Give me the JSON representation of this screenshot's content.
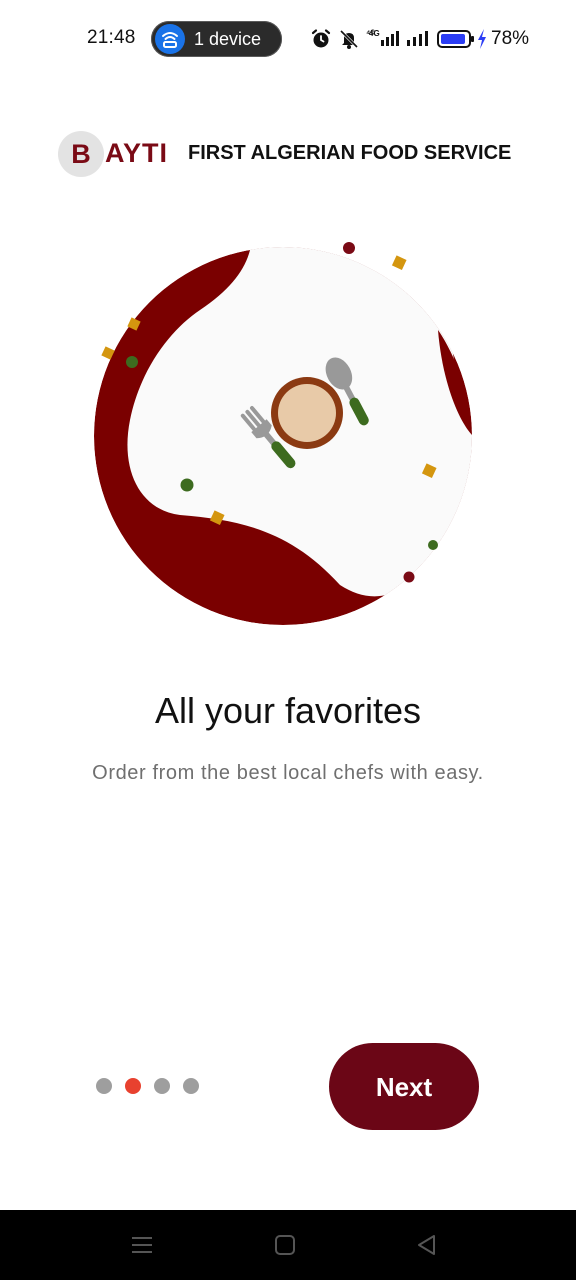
{
  "status_bar": {
    "time": "21:48",
    "device_pill": "1 device",
    "battery": "78%",
    "icons": [
      "wifi-cast-icon",
      "alarm-icon",
      "mute-bell-icon",
      "signal-4g-icon",
      "signal-icon",
      "battery-icon",
      "charging-icon"
    ]
  },
  "header": {
    "logo_letter": "B",
    "logo_rest": "AYTI",
    "tagline": "FIRST ALGERIAN FOOD SERVICE"
  },
  "onboarding": {
    "title": "All your favorites",
    "subtitle": "Order from the best local chefs with easy.",
    "page_count": 4,
    "active_page_index": 1,
    "next_label": "Next"
  },
  "colors": {
    "brand": "#6b0616",
    "brand_text": "#7a0a15",
    "dot_active": "#e8412f",
    "dot_inactive": "#9e9e9e",
    "accent_gold": "#d4960f",
    "accent_green": "#3d6b1f",
    "plate_ring": "#8b3a12",
    "plate_fill": "#e8caa8"
  },
  "nav_bar": {
    "icons": [
      "menu-icon",
      "home-square-icon",
      "back-triangle-icon"
    ]
  }
}
